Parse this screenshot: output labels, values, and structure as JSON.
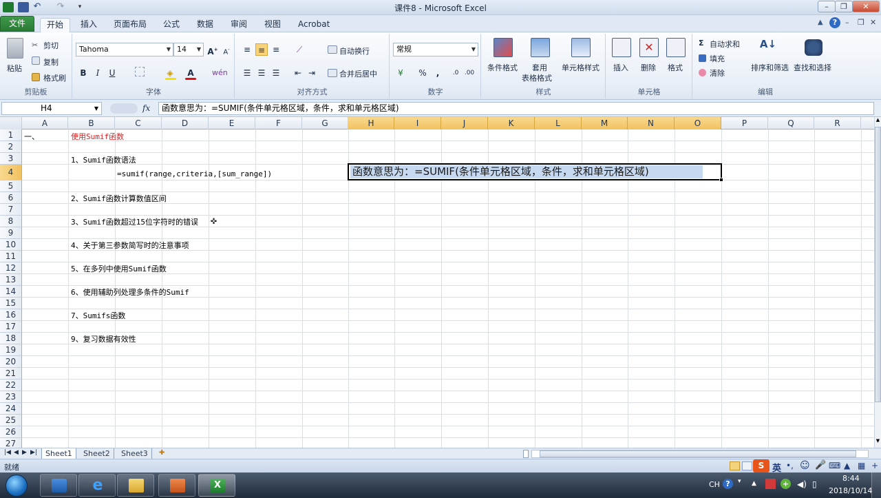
{
  "window": {
    "title": "课件8 - Microsoft Excel"
  },
  "ribbon_tabs": [
    "文件",
    "开始",
    "插入",
    "页面布局",
    "公式",
    "数据",
    "审阅",
    "视图",
    "Acrobat"
  ],
  "clipboard": {
    "paste": "粘贴",
    "cut": "剪切",
    "copy": "复制",
    "format_painter": "格式刷",
    "label": "剪贴板"
  },
  "font": {
    "name": "Tahoma",
    "size": "14",
    "bold": "B",
    "italic": "I",
    "underline": "U",
    "label": "字体"
  },
  "alignment": {
    "wrap": "自动换行",
    "merge": "合并后居中",
    "label": "对齐方式"
  },
  "number": {
    "format": "常规",
    "percent": "%",
    "comma": ",",
    "label": "数字"
  },
  "styles": {
    "conditional": "条件格式",
    "table_line1": "套用",
    "table_line2": "表格格式",
    "cell_styles": "单元格样式",
    "label": "样式"
  },
  "cells": {
    "insert": "插入",
    "delete": "删除",
    "format": "格式",
    "label": "单元格"
  },
  "editing": {
    "autosum": "自动求和",
    "fill": "填充",
    "clear": "清除",
    "sort": "排序和筛选",
    "find": "查找和选择",
    "label": "编辑"
  },
  "formula_bar": {
    "name_box": "H4",
    "fx": "fx",
    "content": "函数意思为：=SUMIF(条件单元格区域，条件，求和单元格区域)"
  },
  "columns": [
    "A",
    "B",
    "C",
    "D",
    "E",
    "F",
    "G",
    "H",
    "I",
    "J",
    "K",
    "L",
    "M",
    "N",
    "O",
    "P",
    "Q",
    "R"
  ],
  "rows": [
    "1",
    "2",
    "3",
    "4",
    "5",
    "6",
    "7",
    "8",
    "9",
    "10",
    "11",
    "12",
    "13",
    "14",
    "15",
    "16",
    "17",
    "18",
    "19",
    "20",
    "21",
    "22",
    "23",
    "24",
    "25",
    "26",
    "27"
  ],
  "cells_content": {
    "a1": "一、",
    "b1": "使用Sumif函数",
    "b3": "1、Sumif函数语法",
    "c4": "=sumif(range,criteria,[sum_range])",
    "b6": "2、Sumif函数计算数值区间",
    "b8": "3、Sumif函数超过15位字符时的错误",
    "b10": "4、关于第三参数简写时的注意事项",
    "b12": "5、在多列中使用Sumif函数",
    "b14": "6、使用辅助列处理多条件的Sumif",
    "b16": "7、Sumifs函数",
    "b18": "9、复习数据有效性",
    "h4": "函数意思为：=SUMIF(条件单元格区域，条件，求和单元格区域)"
  },
  "sheets": [
    "Sheet1",
    "Sheet2",
    "Sheet3"
  ],
  "status": {
    "ready": "就绪"
  },
  "tray": {
    "lang": "CH",
    "ime": "英",
    "time": "8:44",
    "date": "2018/10/14"
  }
}
